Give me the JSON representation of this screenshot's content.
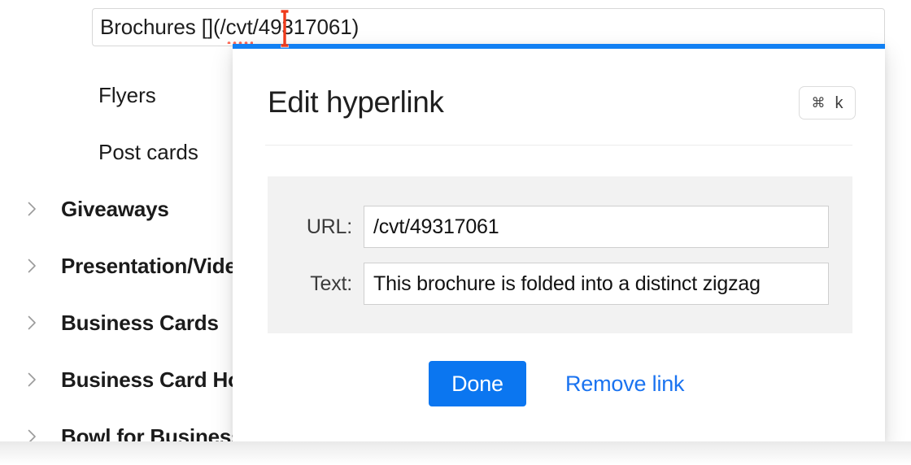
{
  "background_editor": {
    "title_input": {
      "prefix": "Brochures [](/",
      "misspelled_word": "cvt",
      "suffix": "/49317061)",
      "full_value": "Brochures [](/cvt/49317061)"
    },
    "outline_items": [
      {
        "label": "Flyers",
        "level": "child",
        "has_chevron": false
      },
      {
        "label": "Post cards",
        "level": "child",
        "has_chevron": false
      },
      {
        "label": "Giveaways",
        "level": "parent",
        "has_chevron": true,
        "chevron_icon": "chevron-right-icon"
      },
      {
        "label": "Presentation/Video",
        "level": "parent",
        "has_chevron": true,
        "chevron_icon": "chevron-right-icon"
      },
      {
        "label": "Business Cards",
        "level": "parent",
        "has_chevron": true,
        "chevron_icon": "chevron-right-icon"
      },
      {
        "label": "Business Card Holders",
        "level": "parent",
        "has_chevron": true,
        "chevron_icon": "chevron-right-icon"
      },
      {
        "label": "Bowl for Business Cards",
        "level": "parent",
        "has_chevron": true,
        "chevron_icon": "chevron-right-icon"
      }
    ]
  },
  "dialog": {
    "title": "Edit hyperlink",
    "shortcut": {
      "modifier": "⌘",
      "key": "k"
    },
    "fields": [
      {
        "label": "URL:",
        "value": "/cvt/49317061",
        "name": "url"
      },
      {
        "label": "Text:",
        "value": "This brochure is folded into a distinct zigzag",
        "name": "text"
      }
    ],
    "primary_button": "Done",
    "secondary_link": "Remove link"
  },
  "cursor": {
    "type": "i-beam-text-cursor"
  },
  "colors": {
    "accent_blue": "#1180f3",
    "button_blue": "#0b76f0",
    "link_blue": "#1a73f0",
    "panel_gray": "#f2f2f2",
    "cursor_red": "#ef3b1b",
    "spellcheck_red": "#ff6a57"
  }
}
